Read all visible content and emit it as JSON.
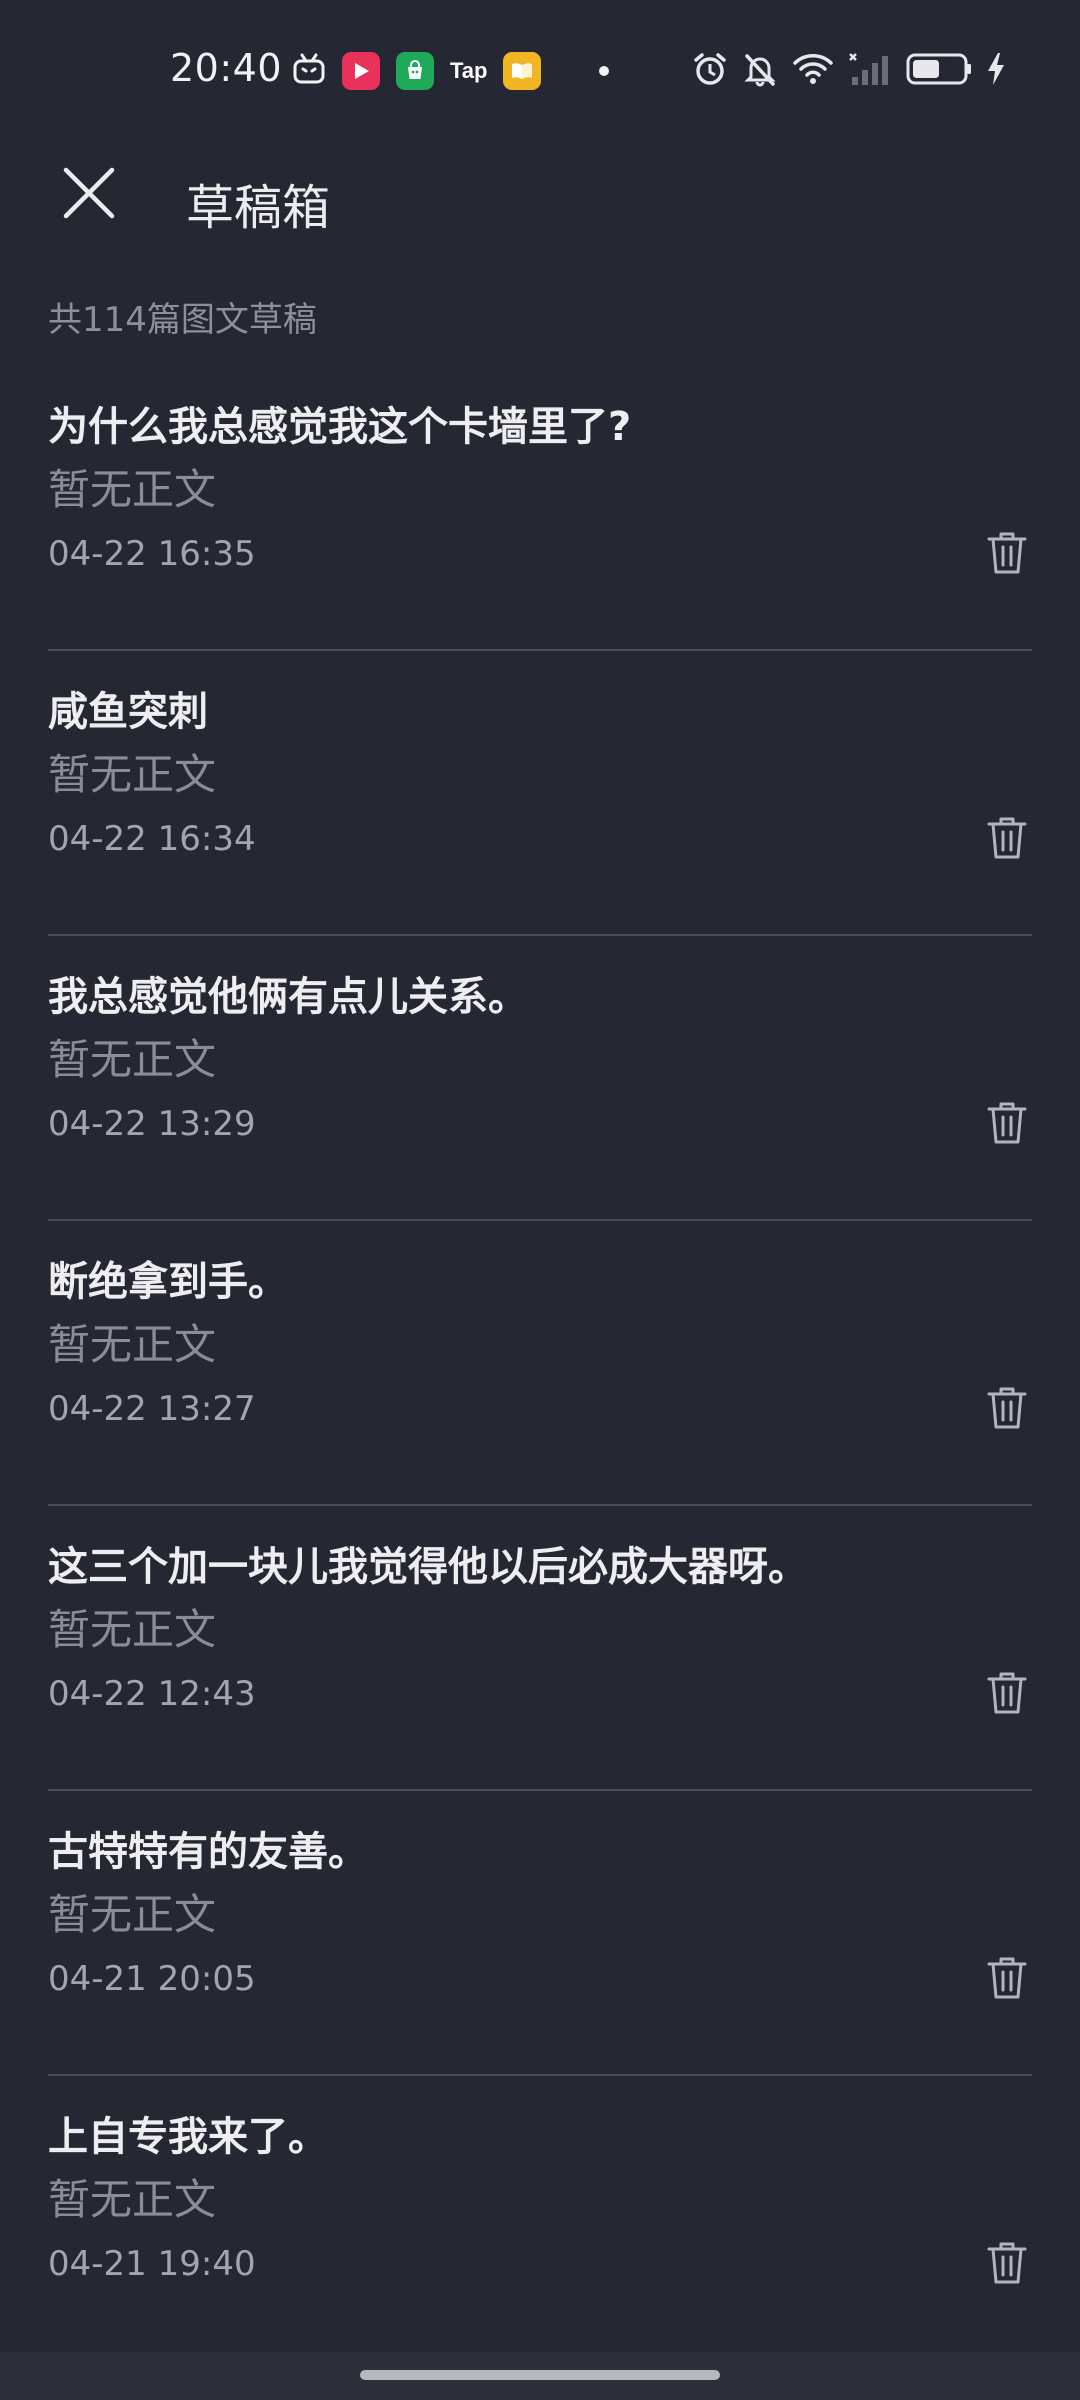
{
  "status_bar": {
    "time": "20:40",
    "left_icons": [
      "bilibili-icon",
      "video-app-icon",
      "shopping-app-icon",
      "taptap-icon",
      "reader-app-icon",
      "notification-dot-icon"
    ],
    "tap_label": "Tap",
    "right_icons": [
      "alarm-icon",
      "mute-icon",
      "wifi-icon",
      "signal-icon",
      "battery-icon",
      "charging-icon"
    ],
    "battery_level": 0.55
  },
  "header": {
    "close_icon": "close-icon",
    "title": "草稿箱"
  },
  "summary": {
    "count_text": "共114篇图文草稿"
  },
  "drafts": [
    {
      "title": "为什么我总感觉我这个卡墙里了?",
      "body": "暂无正文",
      "time": "04-22 16:35"
    },
    {
      "title": "咸鱼突刺",
      "body": "暂无正文",
      "time": "04-22 16:34"
    },
    {
      "title": "我总感觉他俩有点儿关系。",
      "body": "暂无正文",
      "time": "04-22 13:29"
    },
    {
      "title": "断绝拿到手。",
      "body": "暂无正文",
      "time": "04-22 13:27"
    },
    {
      "title": "这三个加一块儿我觉得他以后必成大器呀。",
      "body": "暂无正文",
      "time": "04-22 12:43"
    },
    {
      "title": "古特特有的友善。",
      "body": "暂无正文",
      "time": "04-21 20:05"
    },
    {
      "title": "上自专我来了。",
      "body": "暂无正文",
      "time": "04-21 19:40"
    }
  ],
  "colors": {
    "background": "#252733",
    "divider": "#4a4c58",
    "title_text": "#eeeef1",
    "secondary_text": "#8a8c96"
  }
}
